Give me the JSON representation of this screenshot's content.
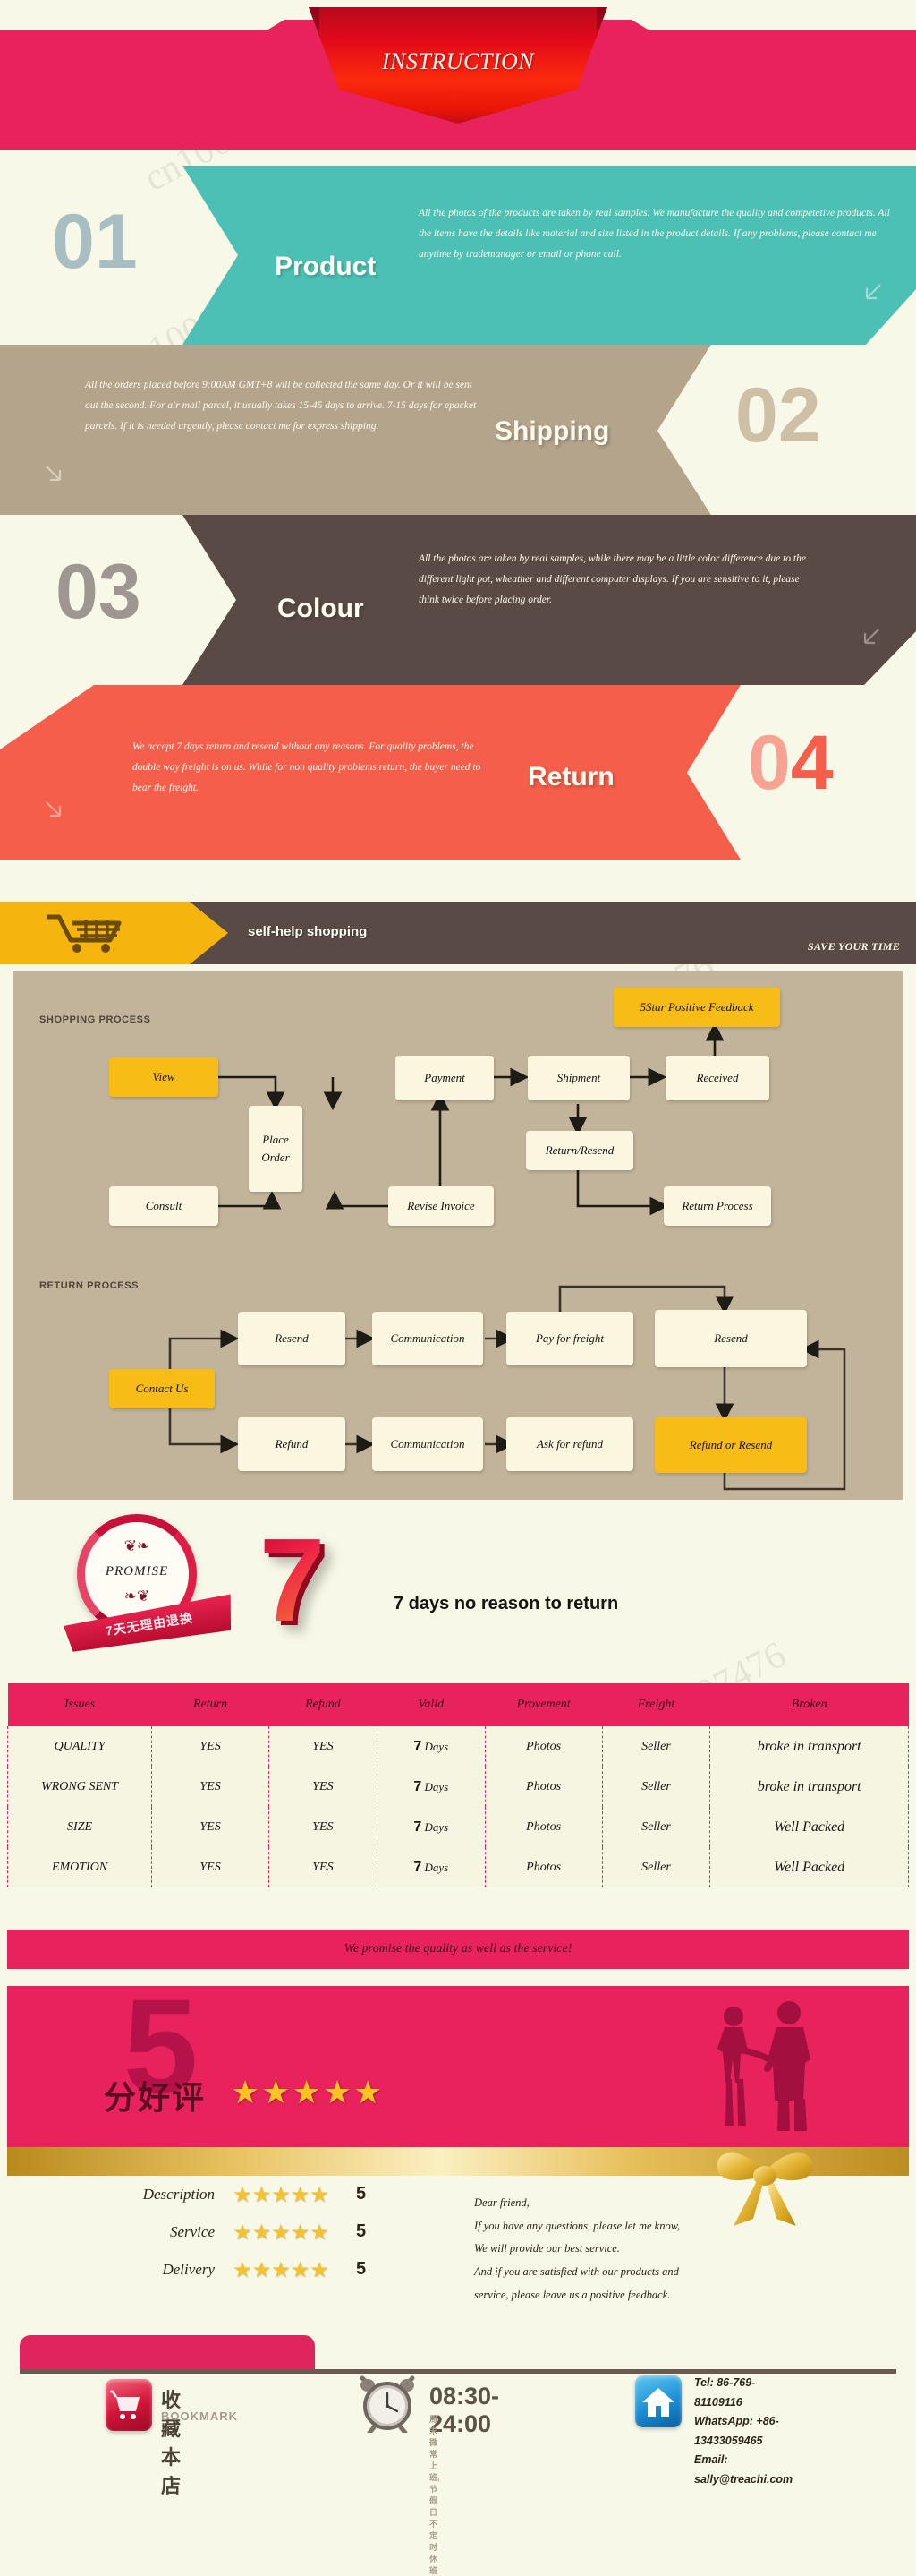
{
  "header": {
    "title": "INSTRUCTION"
  },
  "steps": [
    {
      "number": "01",
      "title": "Product",
      "body": "All the photos of the products are taken by real samples. We manufacture the quality and competetive products. All the items have the details like material and size listed in the product details. If any problems, please contact me anytime by trademanager or email or phone call."
    },
    {
      "number": "02",
      "title": "Shipping",
      "body": "All the orders placed before 9:00AM GMT+8 will be collected the same day. Or it will be sent out the second. For air mail parcel, it usually takes 15-45 days to arrive. 7-15 days for epacket parcels. If it is needed urgently, please contact me for express shipping."
    },
    {
      "number": "03",
      "title": "Colour",
      "body": "All the photos are taken by real samples, while there may be a little color difference due to the different light pot, wheather and different computer displays. If you are sensitive to it, please think twice before placing order."
    },
    {
      "number": "04",
      "number_part1": "0",
      "number_part2": "4",
      "title": "Return",
      "body": "We accept 7 days return and resend without any reasons. For quality problems, the double way freight is on us. While for non quality problems return, the buyer need to bear the freight."
    }
  ],
  "shop_bar": {
    "label": "self-help shopping",
    "tagline": "SAVE YOUR TIME",
    "icon": "shopping-cart-icon"
  },
  "flow": {
    "shopping_heading": "SHOPPING PROCESS",
    "return_heading": "RETURN PROCESS",
    "shopping_nodes": [
      {
        "label": "View"
      },
      {
        "label": "Place Order"
      },
      {
        "label": "Consult"
      },
      {
        "label": "Payment"
      },
      {
        "label": "Revise Invoice"
      },
      {
        "label": "Shipment"
      },
      {
        "label": "Return/Resend"
      },
      {
        "label": "Received"
      },
      {
        "label": "Return Process"
      },
      {
        "label": "5Star Positive Feedback"
      }
    ],
    "return_nodes": [
      {
        "label": "Contact Us"
      },
      {
        "label": "Resend"
      },
      {
        "label": "Communication"
      },
      {
        "label": "Pay for freight"
      },
      {
        "label": "Resend"
      },
      {
        "label": "Refund"
      },
      {
        "label": "Communication"
      },
      {
        "label": "Ask for refund"
      },
      {
        "label": "Refund or Resend"
      }
    ]
  },
  "promise": {
    "seal_text": "PROMISE",
    "banner_cn": "7天无理由退换",
    "big_number": "7",
    "days_text": "7 days no reason to return"
  },
  "table": {
    "headers": [
      "Issues",
      "Return",
      "Refund",
      "Valid",
      "Provement",
      "Freight",
      "Broken"
    ],
    "rows": [
      {
        "issue": "QUALITY",
        "return": "YES",
        "refund": "YES",
        "valid_num": "7",
        "valid_unit": "Days",
        "provement": "Photos",
        "freight": "Seller",
        "broken": "broke in transport"
      },
      {
        "issue": "WRONG SENT",
        "return": "YES",
        "refund": "YES",
        "valid_num": "7",
        "valid_unit": "Days",
        "provement": "Photos",
        "freight": "Seller",
        "broken": "broke in transport"
      },
      {
        "issue": "SIZE",
        "return": "YES",
        "refund": "YES",
        "valid_num": "7",
        "valid_unit": "Days",
        "provement": "Photos",
        "freight": "Seller",
        "broken": "Well Packed"
      },
      {
        "issue": "EMOTION",
        "return": "YES",
        "refund": "YES",
        "valid_num": "7",
        "valid_unit": "Days",
        "provement": "Photos",
        "freight": "Seller",
        "broken": "Well Packed"
      }
    ],
    "promise_bar": "We promise the quality as well as the service!"
  },
  "rating_block": {
    "ghost_number": "5",
    "cn_label": "分好评",
    "stars": "★★★★★"
  },
  "ratings": [
    {
      "label": "Description",
      "stars": "★★★★★",
      "value": "5"
    },
    {
      "label": "Service",
      "stars": "★★★★★",
      "value": "5"
    },
    {
      "label": "Delivery",
      "stars": "★★★★★",
      "value": "5"
    }
  ],
  "letter": {
    "line1": "Dear friend,",
    "line2": "If you have any questions, please let me know,",
    "line3": "We will provide our best service.",
    "line4": "And if you are satisfied with our products and",
    "line5": "service, please leave us a positive feedback."
  },
  "footer": {
    "bookmark_cn": "收藏本店",
    "bookmark_en": "BOOKMARK",
    "hours": "08:30-24:00",
    "hours_note": "周末微常上班,节假日不定时休班",
    "tel": "Tel: 86-769-81109116",
    "whatsapp": "WhatsApp: +86-13433059465",
    "email": "Email: sally@treachi.com"
  },
  "watermark": "cn1000997476",
  "colors": {
    "cream": "#F8F8E8",
    "teal": "#4CC0B4",
    "tan": "#B4A48C",
    "brown": "#5A4A46",
    "coral": "#F45E4A",
    "pink": "#E8225C",
    "yellow": "#F6B50E",
    "flow_bg": "#C2B49A"
  }
}
